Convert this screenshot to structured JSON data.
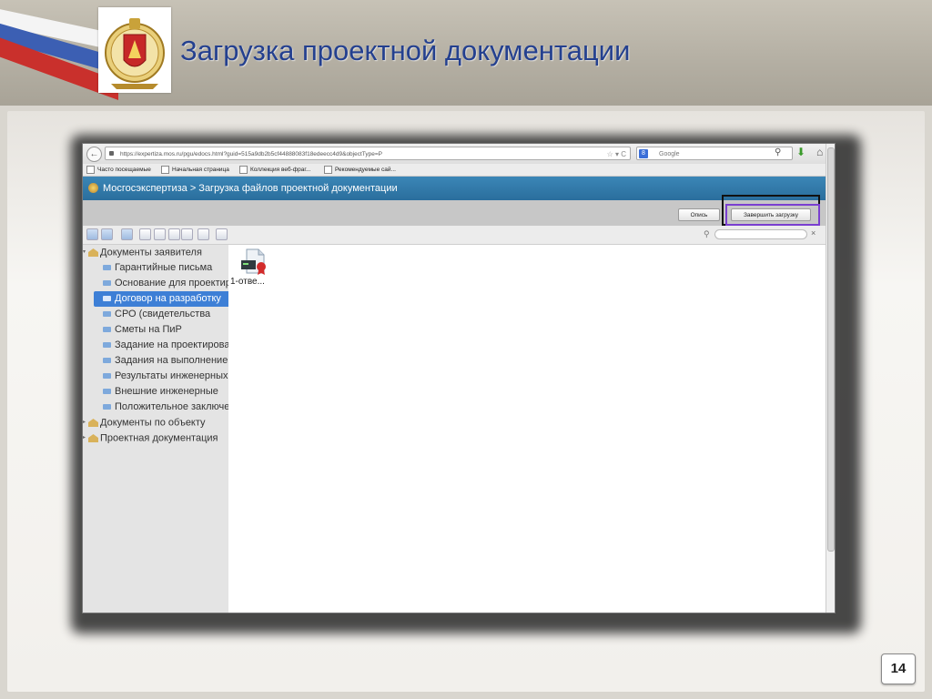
{
  "slide": {
    "title": "Загрузка проектной документации",
    "page_number": "14"
  },
  "browser": {
    "url": "https://expertiza.mos.ru/pgu/edocs.html?guid=515a9db2b5cf44888083f18edeecc4d9&objectType=P",
    "search_placeholder": "Google",
    "bookmarks": [
      "Часто посещаемые",
      "Начальная страница",
      "Коллекция веб-фраг...",
      "Рекомендуемые сай..."
    ]
  },
  "app": {
    "header_title": "Мосгосэкспертиза > Загрузка файлов проектной документации",
    "buttons": {
      "inventory": "Опись",
      "finish_upload": "Завершить загрузку"
    },
    "tree": [
      {
        "label": "Документы заявителя",
        "kind": "root",
        "expanded": true
      },
      {
        "label": "Гарантийные письма",
        "kind": "folder"
      },
      {
        "label": "Основание для проектирования",
        "kind": "folder"
      },
      {
        "label": "Договор на разработку",
        "kind": "folder",
        "selected": true
      },
      {
        "label": "СРО (свидетельства",
        "kind": "folder"
      },
      {
        "label": "Сметы на ПиР",
        "kind": "folder"
      },
      {
        "label": "Задание на проектирование",
        "kind": "folder"
      },
      {
        "label": "Задания на выполнение",
        "kind": "folder"
      },
      {
        "label": "Результаты инженерных",
        "kind": "folder"
      },
      {
        "label": "Внешние инженерные",
        "kind": "folder"
      },
      {
        "label": "Положительное заключение",
        "kind": "folder"
      },
      {
        "label": "Документы по объекту",
        "kind": "root",
        "expanded": false
      },
      {
        "label": "Проектная документация",
        "kind": "root",
        "expanded": false
      }
    ],
    "file": {
      "label": "1-отве..."
    }
  },
  "colors": {
    "title": "#24408f",
    "app_header": "#2f77a8",
    "selection": "#3d7fd6",
    "highlight_frame": "#7a3fd0"
  }
}
